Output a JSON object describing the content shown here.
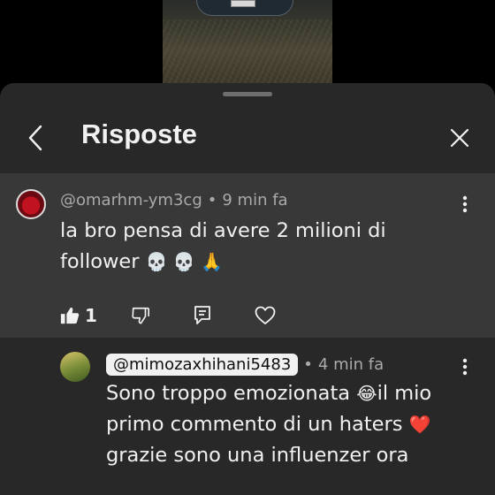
{
  "sheet": {
    "title": "Risposte"
  },
  "comment": {
    "handle": "@omarhm-ym3cg",
    "separator": "•",
    "time": "9 min fa",
    "text": "la bro pensa di avere 2 milioni di follower",
    "emojis": "💀 💀 🙏",
    "like_count": "1"
  },
  "reply": {
    "handle": "@mimozaxhihani5483",
    "separator": "•",
    "time": "4 min fa",
    "line1_text": "Sono troppo emozionata",
    "line1_emoji": "😂",
    "line1_tail": "il mio",
    "line2_text": "primo commento di un haters",
    "line2_emoji": "❤️",
    "line3_text": "grazie sono una influenzer ora"
  },
  "colors": {
    "sheet_bg": "#282828",
    "highlight_bg": "#383838",
    "text_primary": "#f1f1f1",
    "text_secondary": "#aaaaaa"
  },
  "icons": [
    "back-icon",
    "close-icon",
    "more-vert-icon",
    "thumb-up-filled-icon",
    "thumb-down-icon",
    "reply-icon",
    "heart-icon"
  ]
}
